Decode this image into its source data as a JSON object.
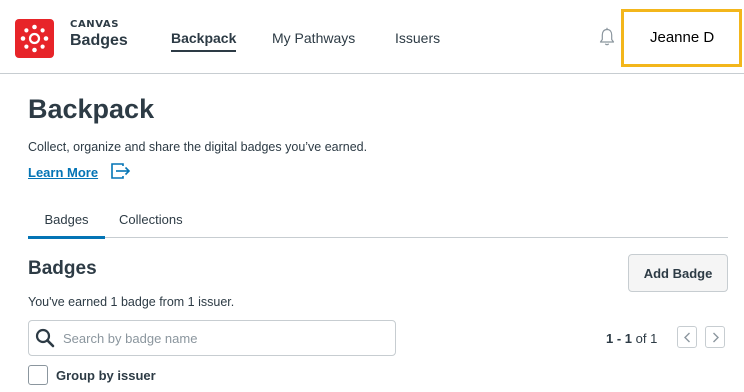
{
  "header": {
    "logo_top": "CANVAS",
    "logo_bottom": "Badges",
    "nav": [
      {
        "label": "Backpack"
      },
      {
        "label": "My Pathways"
      },
      {
        "label": "Issuers"
      }
    ],
    "user_name": "Jeanne D"
  },
  "main": {
    "title": "Backpack",
    "subtitle": "Collect, organize and share the digital badges you’ve earned.",
    "learn_more": "Learn More",
    "tabs": [
      {
        "label": "Badges"
      },
      {
        "label": "Collections"
      }
    ],
    "section_title": "Badges",
    "earned_text": "You've earned 1 badge from 1 issuer.",
    "add_badge_label": "Add Badge",
    "search": {
      "placeholder": "Search by badge name",
      "value": ""
    },
    "pagination": {
      "range": "1 - 1",
      "of_text": "of 1"
    },
    "group_by_label": "Group by issuer",
    "group_by_checked": false
  },
  "colors": {
    "brand_red": "#e72429",
    "link_blue": "#0374b5",
    "highlight_yellow": "#f3b61b",
    "text_dark": "#2d3b45"
  },
  "icons": [
    "canvas-logo-icon",
    "bell-icon",
    "external-link-icon",
    "search-icon",
    "chevron-left-icon",
    "chevron-right-icon"
  ]
}
